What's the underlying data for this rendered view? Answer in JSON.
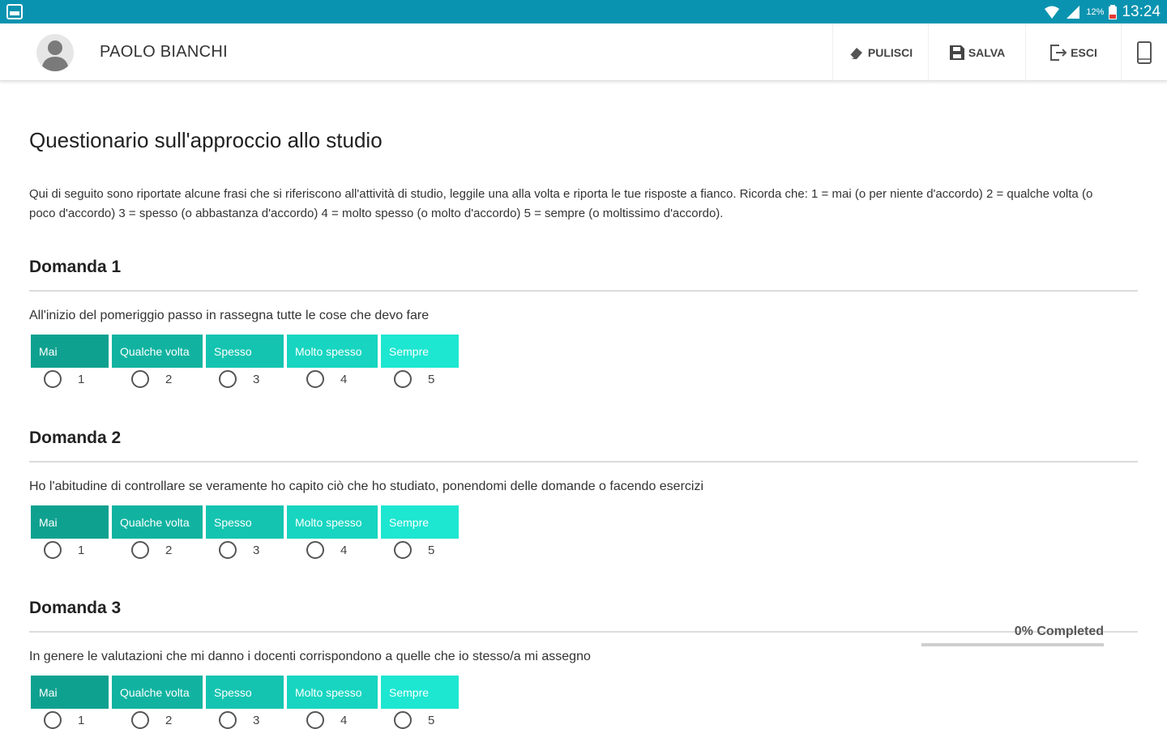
{
  "status_bar": {
    "time": "13:24",
    "battery": "12%",
    "icons": [
      "gallery-icon",
      "wifi-icon",
      "signal-icon",
      "battery-icon"
    ]
  },
  "header": {
    "user_name": "PAOLO BIANCHI",
    "buttons": {
      "clear": "PULISCI",
      "save": "SALVA",
      "exit": "ESCI"
    },
    "icons": {
      "clear": "eraser-icon",
      "save": "floppy-disk-icon",
      "exit": "logout-icon",
      "device": "tablet-icon"
    }
  },
  "page": {
    "title": "Questionario sull'approccio allo studio",
    "intro": "Qui di seguito sono riportate alcune frasi che si riferiscono all'attività di studio, leggile una alla volta e riporta le tue risposte a fianco. Ricorda che: 1 = mai (o per niente d'accordo) 2 = qualche volta (o poco d'accordo) 3 = spesso (o abbastanza d'accordo) 4 = molto spesso (o molto d'accordo) 5 = sempre (o moltissimo d'accordo)."
  },
  "scale_colors": [
    "#0fa18f",
    "#11b3a0",
    "#14c4b0",
    "#17d5c0",
    "#1de6d1"
  ],
  "questions": [
    {
      "title": "Domanda 1",
      "text": "All'inizio del pomeriggio passo in rassegna tutte le cose che devo fare",
      "scale": [
        "Mai",
        "Qualche volta",
        "Spesso",
        "Molto spesso",
        "Sempre"
      ],
      "options": [
        "1",
        "2",
        "3",
        "4",
        "5"
      ]
    },
    {
      "title": "Domanda 2",
      "text": "Ho l'abitudine di controllare se veramente ho capito ciò che ho studiato, ponendomi delle domande o facendo esercizi",
      "scale": [
        "Mai",
        "Qualche volta",
        "Spesso",
        "Molto spesso",
        "Sempre"
      ],
      "options": [
        "1",
        "2",
        "3",
        "4",
        "5"
      ]
    },
    {
      "title": "Domanda 3",
      "text": "In genere le valutazioni che mi danno i docenti corrispondono a quelle che io stesso/a mi assegno",
      "scale": [
        "Mai",
        "Qualche volta",
        "Spesso",
        "Molto spesso",
        "Sempre"
      ],
      "options": [
        "1",
        "2",
        "3",
        "4",
        "5"
      ]
    }
  ],
  "progress": {
    "label": "0% Completed",
    "percent": 0
  }
}
